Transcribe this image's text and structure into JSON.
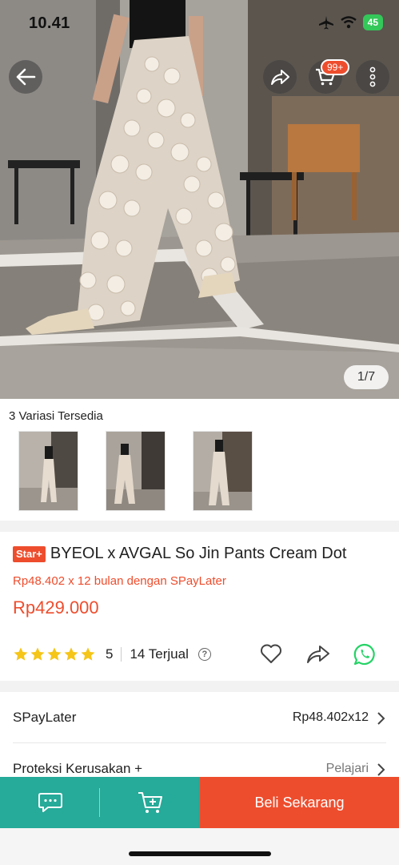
{
  "status_bar": {
    "time": "10.41",
    "battery": "45"
  },
  "top_bar": {
    "cart_badge": "99+"
  },
  "gallery": {
    "counter": "1/7"
  },
  "variants": {
    "title": "3 Variasi Tersedia",
    "count": 3
  },
  "product": {
    "badge": "Star+",
    "title": "BYEOL x AVGAL So Jin Pants Cream Dot",
    "installment_text": "Rp48.402 x 12 bulan dengan SPayLater",
    "price": "Rp429.000",
    "rating": "5",
    "rating_stars": 5,
    "sold": "14 Terjual",
    "help_glyph": "?"
  },
  "rows": [
    {
      "label": "SPayLater",
      "value": "Rp48.402x12"
    },
    {
      "label": "Proteksi Kerusakan +",
      "value": "Pelajari"
    }
  ],
  "bottom_bar": {
    "buy_label": "Beli Sekarang"
  },
  "colors": {
    "brand": "#ee4d2d",
    "teal": "#26aa99",
    "star": "#f5c518",
    "whatsapp": "#25d366"
  },
  "icons": [
    "back-arrow-icon",
    "share-icon",
    "cart-icon",
    "more-vertical-icon",
    "star-icon",
    "help-icon",
    "heart-icon",
    "whatsapp-icon",
    "chevron-right-icon",
    "chat-icon",
    "add-to-cart-icon"
  ]
}
